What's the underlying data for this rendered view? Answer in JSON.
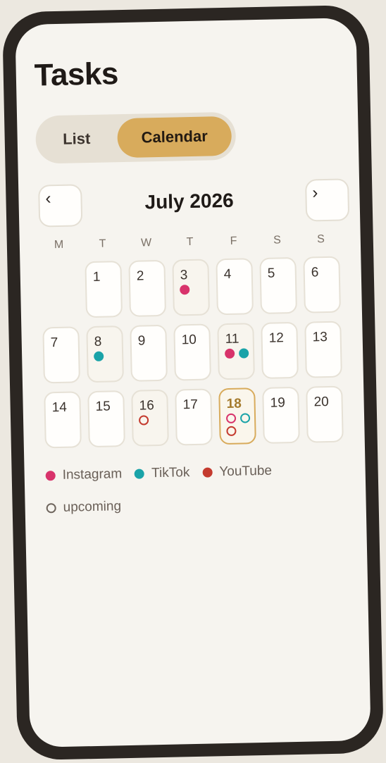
{
  "page": {
    "title": "Tasks"
  },
  "view_toggle": {
    "list_label": "List",
    "calendar_label": "Calendar",
    "active": "Calendar"
  },
  "calendar": {
    "month_label": "July 2026",
    "prev_label": "‹",
    "next_label": "›",
    "weekdays": [
      "M",
      "T",
      "W",
      "T",
      "F",
      "S",
      "S"
    ],
    "today": 18,
    "weeks": [
      [
        null,
        1,
        2,
        3,
        4,
        5,
        6
      ],
      [
        7,
        8,
        9,
        10,
        11,
        12,
        13
      ],
      [
        14,
        15,
        16,
        17,
        18,
        19,
        20
      ]
    ],
    "events": {
      "3": [
        {
          "platform": "instagram",
          "style": "filled"
        }
      ],
      "8": [
        {
          "platform": "tiktok",
          "style": "filled"
        }
      ],
      "11": [
        {
          "platform": "instagram",
          "style": "filled"
        },
        {
          "platform": "tiktok",
          "style": "filled"
        }
      ],
      "16": [
        {
          "platform": "youtube",
          "style": "outline"
        }
      ],
      "18": [
        {
          "platform": "instagram",
          "style": "outline"
        },
        {
          "platform": "tiktok",
          "style": "outline"
        },
        {
          "platform": "youtube",
          "style": "outline"
        }
      ]
    }
  },
  "colors": {
    "instagram": "#d8336b",
    "tiktok": "#1aa3a8",
    "youtube": "#c43a2e",
    "upcoming": "#6e655d",
    "accent": "#d8ab5c"
  },
  "legend": {
    "items": [
      {
        "key": "instagram",
        "label": "Instagram"
      },
      {
        "key": "tiktok",
        "label": "TikTok"
      },
      {
        "key": "youtube",
        "label": "YouTube"
      }
    ],
    "upcoming_label": "upcoming"
  }
}
